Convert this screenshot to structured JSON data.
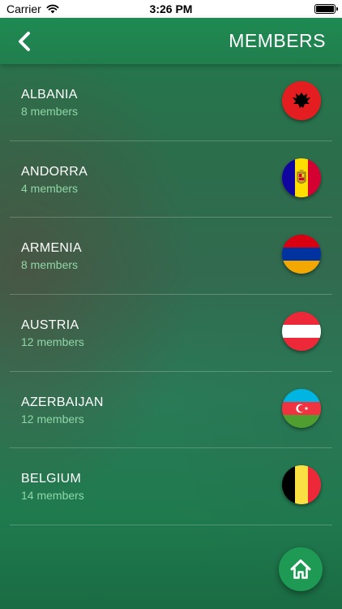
{
  "status_bar": {
    "carrier": "Carrier",
    "time": "3:26 PM"
  },
  "header": {
    "title": "MEMBERS",
    "back_icon": "chevron-left-icon"
  },
  "colors": {
    "nav_bar": "#1e8a52",
    "member_count_text": "#8fd7a7",
    "home_button": "#1f9a55"
  },
  "members": [
    {
      "country": "ALBANIA",
      "count": "8 members",
      "flag_icon": "albania-flag-icon"
    },
    {
      "country": "ANDORRA",
      "count": "4 members",
      "flag_icon": "andorra-flag-icon"
    },
    {
      "country": "ARMENIA",
      "count": "8 members",
      "flag_icon": "armenia-flag-icon"
    },
    {
      "country": "AUSTRIA",
      "count": "12 members",
      "flag_icon": "austria-flag-icon"
    },
    {
      "country": "AZERBAIJAN",
      "count": "12 members",
      "flag_icon": "azerbaijan-flag-icon"
    },
    {
      "country": "BELGIUM",
      "count": "14 members",
      "flag_icon": "belgium-flag-icon"
    }
  ],
  "footer": {
    "home_icon": "home-icon"
  }
}
